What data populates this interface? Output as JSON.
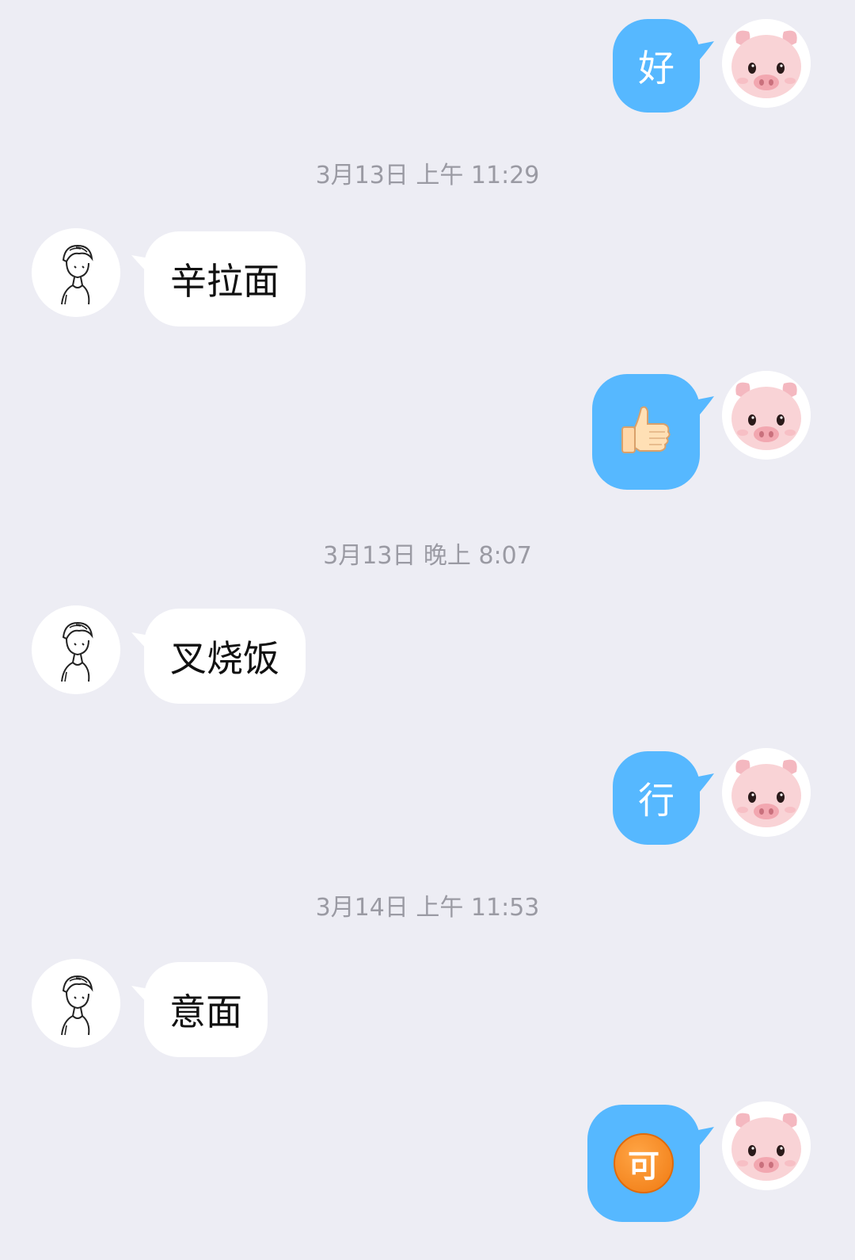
{
  "messages": [
    {
      "side": "outgoing",
      "text": "好"
    },
    {
      "side": "timestamp",
      "text": "3月13日 上午 11:29"
    },
    {
      "side": "incoming",
      "text": "辛拉面"
    },
    {
      "side": "outgoing",
      "emoji": "thumbs-up"
    },
    {
      "side": "timestamp",
      "text": "3月13日 晚上 8:07"
    },
    {
      "side": "incoming",
      "text": "叉烧饭"
    },
    {
      "side": "outgoing",
      "text": "行"
    },
    {
      "side": "timestamp",
      "text": "3月14日 上午 11:53"
    },
    {
      "side": "incoming",
      "text": "意面"
    },
    {
      "side": "outgoing",
      "emoji_text": "可"
    }
  ],
  "colors": {
    "background": "#EDEDF4",
    "outgoing_bubble": "#56B8FF",
    "incoming_bubble": "#FFFFFF",
    "timestamp_text": "#9A9AA3"
  },
  "icons": {
    "incoming_avatar": "sketch-person-avatar-icon",
    "outgoing_avatar": "pig-avatar-icon",
    "thumbs_up": "thumbs-up-emoji-icon",
    "ke_emoji": "ke-emoji-icon"
  }
}
